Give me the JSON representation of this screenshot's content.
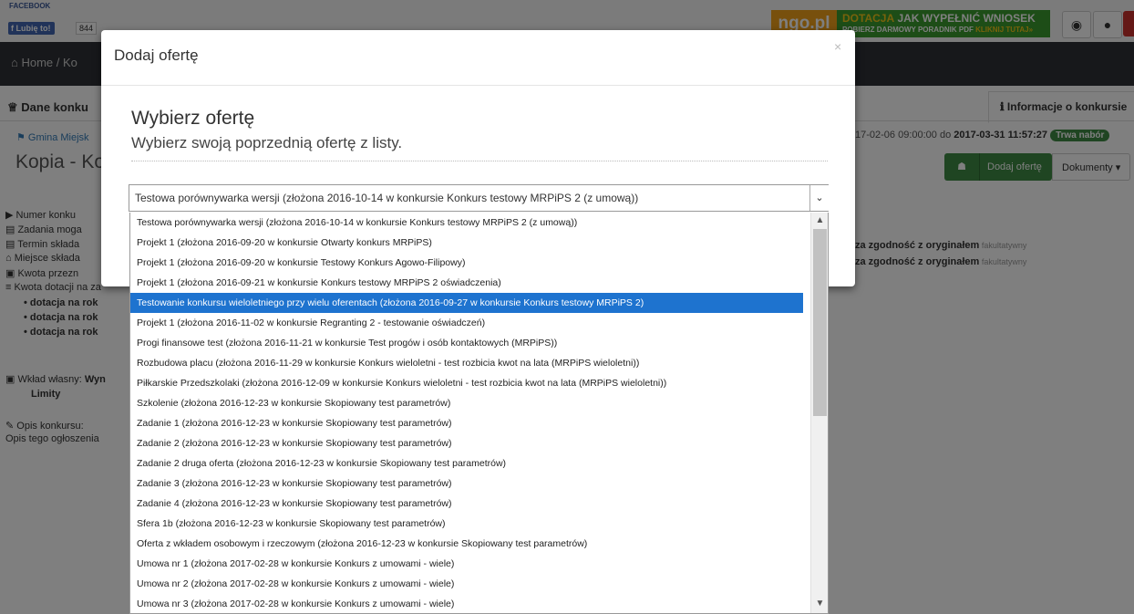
{
  "topbar": {
    "facebook_label": "FACEBOOK",
    "like_label": "Lubię to!",
    "like_count": "844",
    "ad_logo": "ngo.pl",
    "ad_line1_a": "DOTACJA",
    "ad_line1_b": " JAK WYPEŁNIĆ WNIOSEK",
    "ad_line2_a": "POBIERZ DARMOWY PORADNIK PDF ",
    "ad_line2_b": "KLIKNIJ TUTAJ»"
  },
  "nav": {
    "home_label": "Home / Ko"
  },
  "tabs": {
    "left": "Dane konku",
    "right": "Informacje o konkursie"
  },
  "page": {
    "gmina_link": "Gmina Miejsk",
    "dates_prefix": "17-02-06 09:00:00 do ",
    "dates_end": "2017-03-31 11:57:27",
    "status_badge": "Trwa nabór",
    "title": "Kopia - Ko",
    "add_offer_button": "Dodaj ofertę",
    "documents_button": "Dokumenty ▾",
    "info": [
      "Numer konku",
      "Zadania moga",
      "Termin składa",
      "Miejsce składa",
      "Kwota przezn",
      "Kwota dotacji na za"
    ],
    "bullets": [
      "• dotacja na rok",
      "• dotacja na rok",
      "• dotacja na rok"
    ],
    "wklad_label": "Wkład własny: ",
    "wklad_value": "Wyn",
    "limity": "Limity",
    "opis_label": "Opis konkursu:",
    "opis_text": "Opis tego ogłoszenia",
    "right_info": [
      {
        "bold": "za zgodność z oryginałem",
        "note": " fakultatywny"
      },
      {
        "bold": "za zgodność z oryginałem",
        "note": " fakultatywny"
      }
    ]
  },
  "modal": {
    "title": "Dodaj ofertę",
    "close": "×",
    "heading": "Wybierz ofertę",
    "subheading": "Wybierz swoją poprzednią ofertę z listy.",
    "select_value": "Testowa porównywarka wersji (złożona 2016-10-14 w konkursie Konkurs testowy MRPiPS 2 (z umową))",
    "selected_index": 4,
    "options": [
      "Testowa porównywarka wersji (złożona 2016-10-14 w konkursie Konkurs testowy MRPiPS 2 (z umową))",
      "Projekt 1 (złożona 2016-09-20 w konkursie Otwarty konkurs MRPiPS)",
      "Projekt 1 (złożona 2016-09-20 w konkursie Testowy Konkurs Agowo-Filipowy)",
      "Projekt 1 (złożona 2016-09-21 w konkursie Konkurs testowy MRPiPS 2 oświadczenia)",
      "Testowanie konkursu wieloletniego przy wielu oferentach (złożona 2016-09-27 w konkursie Konkurs testowy MRPiPS 2)",
      "Projekt 1 (złożona 2016-11-02 w konkursie Regranting 2 - testowanie oświadczeń)",
      "Progi finansowe test (złożona 2016-11-21 w konkursie Test progów i osób kontaktowych (MRPiPS))",
      "Rozbudowa placu (złożona 2016-11-29 w konkursie Konkurs wieloletni - test rozbicia kwot na lata (MRPiPS wieloletni))",
      "Piłkarskie Przedszkolaki (złożona 2016-12-09 w konkursie Konkurs wieloletni - test rozbicia kwot na lata (MRPiPS wieloletni))",
      "Szkolenie (złożona 2016-12-23 w konkursie Skopiowany test parametrów)",
      "Zadanie 1 (złożona 2016-12-23 w konkursie Skopiowany test parametrów)",
      "Zadanie 2 (złożona 2016-12-23 w konkursie Skopiowany test parametrów)",
      "Zadanie 2 druga oferta (złożona 2016-12-23 w konkursie Skopiowany test parametrów)",
      "Zadanie 3 (złożona 2016-12-23 w konkursie Skopiowany test parametrów)",
      "Zadanie 4 (złożona 2016-12-23 w konkursie Skopiowany test parametrów)",
      "Sfera 1b (złożona 2016-12-23 w konkursie Skopiowany test parametrów)",
      "Oferta z wkładem osobowym i rzeczowym (złożona 2016-12-23 w konkursie Skopiowany test parametrów)",
      "Umowa nr 1 (złożona 2017-02-28 w konkursie Konkurs z umowami - wiele)",
      "Umowa nr 2 (złożona 2017-02-28 w konkursie Konkurs z umowami - wiele)",
      "Umowa nr 3 (złożona 2017-02-28 w konkursie Konkurs z umowami - wiele)"
    ]
  }
}
